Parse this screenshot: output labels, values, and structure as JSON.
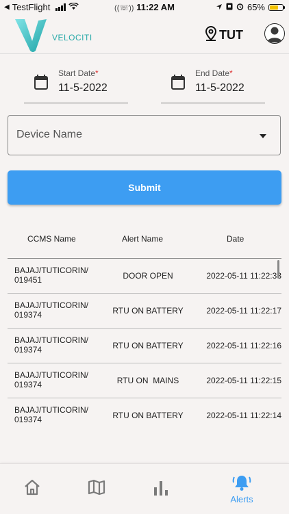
{
  "status_bar": {
    "back_app": "TestFlight",
    "time": "11:22 AM",
    "battery": "65%",
    "battery_level": 0.65
  },
  "app_bar": {
    "brand": "VELOCITI",
    "location": "TUT"
  },
  "filters": {
    "start_date": {
      "label": "Start Date",
      "required_mark": "*",
      "value": "11-5-2022"
    },
    "end_date": {
      "label": "End Date",
      "required_mark": "*",
      "value": "11-5-2022"
    },
    "device": {
      "placeholder": "Device Name"
    },
    "submit_label": "Submit"
  },
  "table": {
    "headers": [
      "CCMS Name",
      "Alert Name",
      "Date"
    ],
    "rows": [
      {
        "ccms_line1": "BAJAJ/TUTICORIN/",
        "ccms_line2": "019451",
        "alert": "DOOR OPEN",
        "date": "2022-05-11 11:22:33"
      },
      {
        "ccms_line1": "BAJAJ/TUTICORIN/",
        "ccms_line2": "019374",
        "alert": "RTU ON BATTERY",
        "date": "2022-05-11 11:22:17"
      },
      {
        "ccms_line1": "BAJAJ/TUTICORIN/",
        "ccms_line2": "019374",
        "alert": "RTU ON BATTERY",
        "date": "2022-05-11 11:22:16"
      },
      {
        "ccms_line1": "BAJAJ/TUTICORIN/",
        "ccms_line2": "019374",
        "alert": "RTU ON  MAINS",
        "date": "2022-05-11 11:22:15"
      },
      {
        "ccms_line1": "BAJAJ/TUTICORIN/",
        "ccms_line2": "019374",
        "alert": "RTU ON BATTERY",
        "date": "2022-05-11 11:22:14"
      }
    ]
  },
  "bottom_nav": {
    "items": [
      {
        "icon": "home-icon"
      },
      {
        "icon": "map-icon"
      },
      {
        "icon": "bar-chart-icon"
      },
      {
        "icon": "bell-alert-icon",
        "label": "Alerts",
        "active": true
      }
    ]
  },
  "colors": {
    "accent": "#3d9df2",
    "brand": "#27a9a8",
    "background": "#f6f3f2"
  }
}
